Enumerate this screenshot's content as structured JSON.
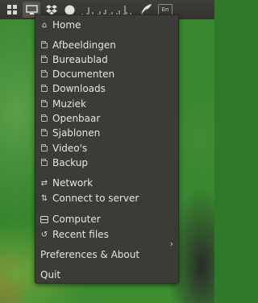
{
  "topbar": {
    "lang": "En"
  },
  "menu": {
    "home": {
      "icon": "home-icon",
      "label": "Home"
    },
    "folders": [
      {
        "icon": "folder-icon",
        "label": "Afbeeldingen"
      },
      {
        "icon": "folder-icon",
        "label": "Bureaublad"
      },
      {
        "icon": "folder-icon",
        "label": "Documenten"
      },
      {
        "icon": "folder-icon",
        "label": "Downloads"
      },
      {
        "icon": "folder-icon",
        "label": "Muziek"
      },
      {
        "icon": "folder-icon",
        "label": "Openbaar"
      },
      {
        "icon": "folder-icon",
        "label": "Sjablonen"
      },
      {
        "icon": "folder-icon",
        "label": "Video's"
      },
      {
        "icon": "folder-icon",
        "label": "Backup"
      }
    ],
    "network": {
      "icon": "network-icon",
      "label": "Network"
    },
    "connect": {
      "icon": "connect-icon",
      "label": "Connect to server"
    },
    "computer": {
      "icon": "drive-icon",
      "label": "Computer"
    },
    "recent": {
      "icon": "history-icon",
      "label": "Recent files"
    },
    "preferences": {
      "label": "Preferences & About"
    },
    "quit": {
      "label": "Quit"
    }
  },
  "colors": {
    "menu_bg": "#3c3b37",
    "panel_bg": "#3f3e3a",
    "text": "#e6e4de"
  }
}
